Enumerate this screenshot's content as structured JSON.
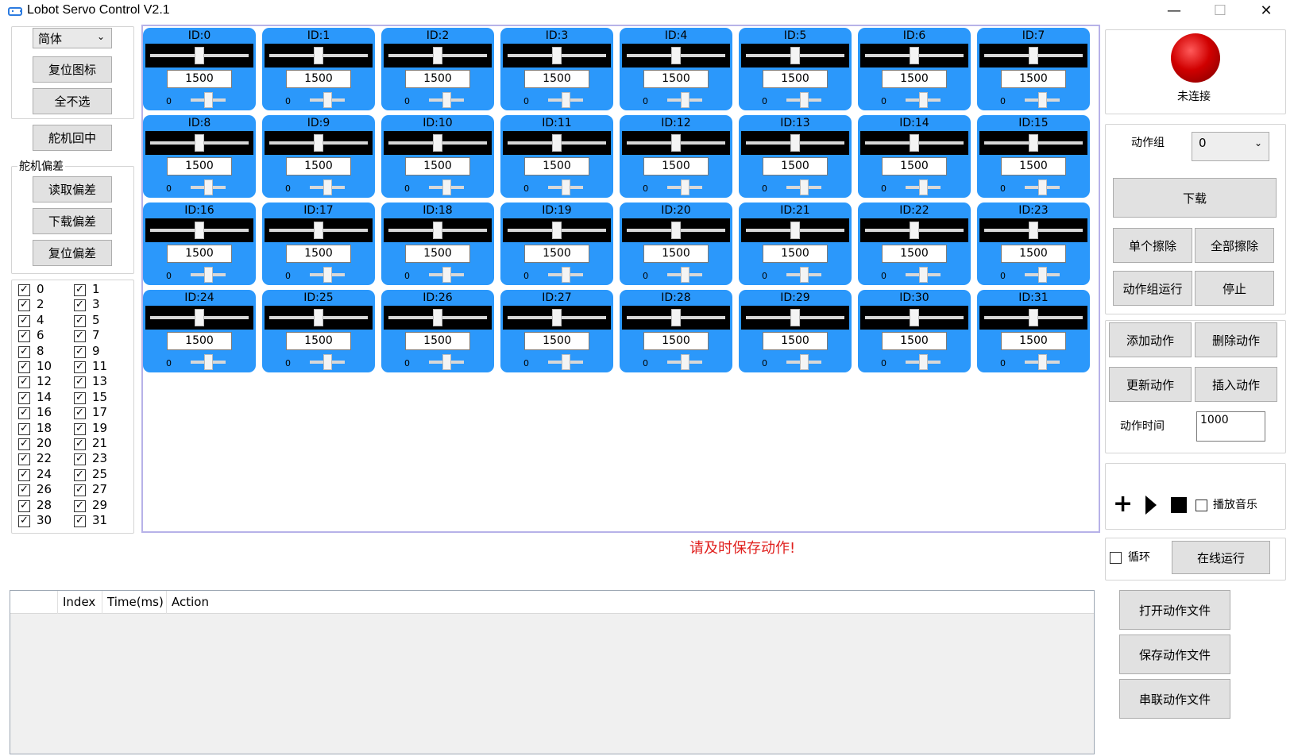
{
  "window": {
    "title": "Lobot Servo Control V2.1",
    "minimize": "—",
    "maximize": "☐",
    "close": "✕"
  },
  "left": {
    "language_select": "简体",
    "reset_icon_button": "复位图标",
    "deselect_all_button": "全不选",
    "center_servo_button": "舵机回中",
    "offset_group_label": "舵机偏差",
    "read_offset_button": "读取偏差",
    "download_offset_button": "下载偏差",
    "reset_offset_button": "复位偏差",
    "servo_checks": [
      "0",
      "1",
      "2",
      "3",
      "4",
      "5",
      "6",
      "7",
      "8",
      "9",
      "10",
      "11",
      "12",
      "13",
      "14",
      "15",
      "16",
      "17",
      "18",
      "19",
      "20",
      "21",
      "22",
      "23",
      "24",
      "25",
      "26",
      "27",
      "28",
      "29",
      "30",
      "31"
    ]
  },
  "servos": [
    {
      "id": "ID:0",
      "value": "1500",
      "min": "0"
    },
    {
      "id": "ID:1",
      "value": "1500",
      "min": "0"
    },
    {
      "id": "ID:2",
      "value": "1500",
      "min": "0"
    },
    {
      "id": "ID:3",
      "value": "1500",
      "min": "0"
    },
    {
      "id": "ID:4",
      "value": "1500",
      "min": "0"
    },
    {
      "id": "ID:5",
      "value": "1500",
      "min": "0"
    },
    {
      "id": "ID:6",
      "value": "1500",
      "min": "0"
    },
    {
      "id": "ID:7",
      "value": "1500",
      "min": "0"
    },
    {
      "id": "ID:8",
      "value": "1500",
      "min": "0"
    },
    {
      "id": "ID:9",
      "value": "1500",
      "min": "0"
    },
    {
      "id": "ID:10",
      "value": "1500",
      "min": "0"
    },
    {
      "id": "ID:11",
      "value": "1500",
      "min": "0"
    },
    {
      "id": "ID:12",
      "value": "1500",
      "min": "0"
    },
    {
      "id": "ID:13",
      "value": "1500",
      "min": "0"
    },
    {
      "id": "ID:14",
      "value": "1500",
      "min": "0"
    },
    {
      "id": "ID:15",
      "value": "1500",
      "min": "0"
    },
    {
      "id": "ID:16",
      "value": "1500",
      "min": "0"
    },
    {
      "id": "ID:17",
      "value": "1500",
      "min": "0"
    },
    {
      "id": "ID:18",
      "value": "1500",
      "min": "0"
    },
    {
      "id": "ID:19",
      "value": "1500",
      "min": "0"
    },
    {
      "id": "ID:20",
      "value": "1500",
      "min": "0"
    },
    {
      "id": "ID:21",
      "value": "1500",
      "min": "0"
    },
    {
      "id": "ID:22",
      "value": "1500",
      "min": "0"
    },
    {
      "id": "ID:23",
      "value": "1500",
      "min": "0"
    },
    {
      "id": "ID:24",
      "value": "1500",
      "min": "0"
    },
    {
      "id": "ID:25",
      "value": "1500",
      "min": "0"
    },
    {
      "id": "ID:26",
      "value": "1500",
      "min": "0"
    },
    {
      "id": "ID:27",
      "value": "1500",
      "min": "0"
    },
    {
      "id": "ID:28",
      "value": "1500",
      "min": "0"
    },
    {
      "id": "ID:29",
      "value": "1500",
      "min": "0"
    },
    {
      "id": "ID:30",
      "value": "1500",
      "min": "0"
    },
    {
      "id": "ID:31",
      "value": "1500",
      "min": "0"
    }
  ],
  "warning_text": "请及时保存动作!",
  "right": {
    "connection_status": "未连接",
    "action_group_label": "动作组",
    "action_group_value": "0",
    "download_button": "下载",
    "erase_single_button": "单个擦除",
    "erase_all_button": "全部擦除",
    "run_group_button": "动作组运行",
    "stop_button": "停止",
    "add_action_button": "添加动作",
    "delete_action_button": "删除动作",
    "update_action_button": "更新动作",
    "insert_action_button": "插入动作",
    "action_time_label": "动作时间",
    "action_time_value": "1000",
    "play_music_label": "播放音乐",
    "loop_label": "循环",
    "online_run_button": "在线运行",
    "open_file_button": "打开动作文件",
    "save_file_button": "保存动作文件",
    "chain_file_button": "串联动作文件"
  },
  "table": {
    "columns": [
      "",
      "Index",
      "Time(ms)",
      "Action"
    ]
  },
  "colors": {
    "card_blue": "#2b98fb",
    "warning_red": "#e0201e",
    "status_led": "#c00000"
  }
}
